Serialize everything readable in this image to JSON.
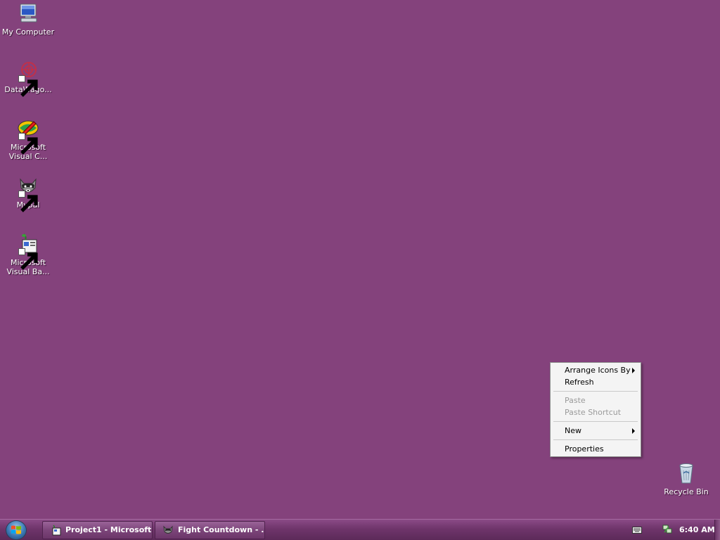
{
  "desktop": {
    "background": "#84427c",
    "icons": [
      {
        "label": "My Computer",
        "icon": "computer-icon",
        "shortcut": false
      },
      {
        "label": "DataWago...",
        "icon": "datawagon-icon",
        "shortcut": true
      },
      {
        "label": "Microsoft Visual C...",
        "icon": "visual-cpp-icon",
        "shortcut": true
      },
      {
        "label": "Mypal",
        "icon": "mypal-raccoon-icon",
        "shortcut": true
      },
      {
        "label": "Microsoft Visual Ba...",
        "icon": "visual-basic-icon",
        "shortcut": true
      },
      {
        "label": "Recycle Bin",
        "icon": "recycle-bin-icon",
        "shortcut": false
      }
    ]
  },
  "context_menu": {
    "items": [
      {
        "label": "Arrange Icons By",
        "enabled": true,
        "submenu": true
      },
      {
        "label": "Refresh",
        "enabled": true,
        "submenu": false
      },
      {
        "label": "Paste",
        "enabled": false,
        "submenu": false
      },
      {
        "label": "Paste Shortcut",
        "enabled": false,
        "submenu": false
      },
      {
        "label": "New",
        "enabled": true,
        "submenu": true
      },
      {
        "label": "Properties",
        "enabled": true,
        "submenu": false
      }
    ]
  },
  "taskbar": {
    "start_icon": "windows-start-orb-icon",
    "tasks": [
      {
        "label": "Project1 - Microsoft ...",
        "icon": "visual-basic-icon"
      },
      {
        "label": "Fight Countdown - ...",
        "icon": "mypal-raccoon-icon"
      }
    ],
    "tray": {
      "icons": [
        "keyboard-icon",
        "network-icon"
      ],
      "clock": "6:40 AM"
    }
  }
}
